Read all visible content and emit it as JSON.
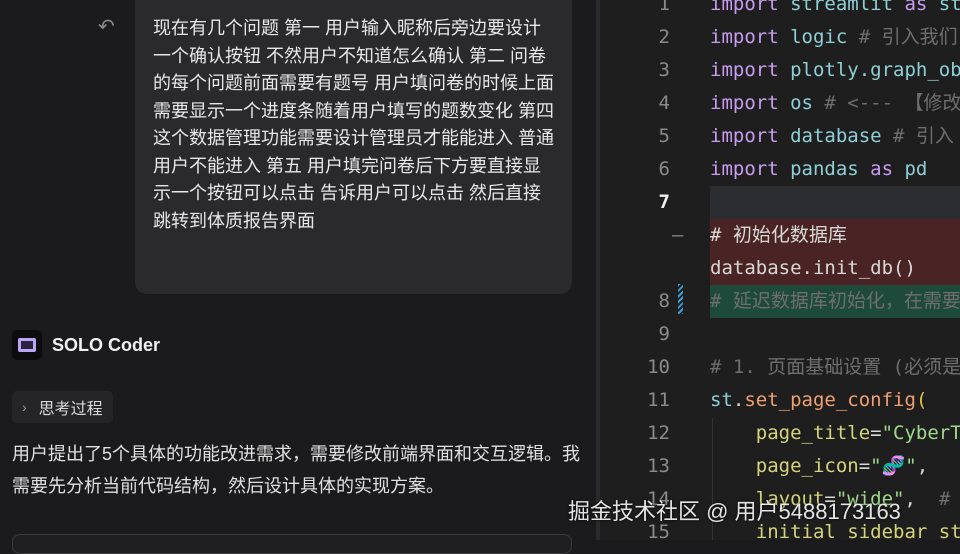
{
  "chat": {
    "undo_icon": "undo-icon",
    "user_message": "现在有几个问题 第一 用户输入昵称后旁边要设计一个确认按钮 不然用户不知道怎么确认 第二 问卷的每个问题前面需要有题号 用户填问卷的时候上面需要显示一个进度条随着用户填写的题数变化 第四这个数据管理功能需要设计管理员才能能进入 普通用户不能进入 第五 用户填完问卷后下方要直接显示一个按钮可以点击 告诉用户可以点击 然后直接跳转到体质报告界面",
    "agent_name": "SOLO Coder",
    "thinking_label": "思考过程",
    "reply": "用户提出了5个具体的功能改进需求，需要修改前端界面和交互逻辑。我需要先分析当前代码结构，然后设计具体的实现方案。"
  },
  "editor": {
    "lines": [
      {
        "n": "1",
        "tokens": [
          [
            "k",
            "import "
          ],
          [
            "i",
            "streamlit "
          ],
          [
            "k",
            "as "
          ],
          [
            "i",
            "st"
          ]
        ]
      },
      {
        "n": "2",
        "tokens": [
          [
            "k",
            "import "
          ],
          [
            "i",
            "logic "
          ],
          [
            "c",
            "# 引入我们"
          ]
        ]
      },
      {
        "n": "3",
        "tokens": [
          [
            "k",
            "import "
          ],
          [
            "i",
            "plotly.graph_ob"
          ]
        ]
      },
      {
        "n": "4",
        "tokens": [
          [
            "k",
            "import "
          ],
          [
            "i",
            "os "
          ],
          [
            "c",
            "# <--- 【修改"
          ]
        ]
      },
      {
        "n": "5",
        "tokens": [
          [
            "k",
            "import "
          ],
          [
            "i",
            "database "
          ],
          [
            "c",
            "# 引入"
          ]
        ]
      },
      {
        "n": "6",
        "tokens": [
          [
            "k",
            "import "
          ],
          [
            "i",
            "pandas "
          ],
          [
            "k",
            "as "
          ],
          [
            "i",
            "pd"
          ]
        ]
      },
      {
        "n": "7",
        "state": "current",
        "tokens": []
      },
      {
        "n": "",
        "state": "deleted",
        "tokens": [
          [
            "t",
            "# 初始化数据库"
          ]
        ]
      },
      {
        "n": "",
        "state": "deleted",
        "tokens": [
          [
            "t",
            "database.init_db()"
          ]
        ]
      },
      {
        "n": "8",
        "state": "added",
        "tokens": [
          [
            "c",
            "# 延迟数据库初始化，在需要"
          ]
        ]
      },
      {
        "n": "9",
        "tokens": []
      },
      {
        "n": "10",
        "tokens": [
          [
            "c",
            "# 1. 页面基础设置 (必须是"
          ]
        ]
      },
      {
        "n": "11",
        "tokens": [
          [
            "i",
            "st"
          ],
          [
            "t",
            "."
          ],
          [
            "f",
            "set_page_config"
          ],
          [
            "y",
            "("
          ]
        ]
      },
      {
        "n": "12",
        "tokens": [
          [
            "p",
            "    page_title"
          ],
          [
            "t",
            "="
          ],
          [
            "s",
            "\"CyberT"
          ]
        ]
      },
      {
        "n": "13",
        "tokens": [
          [
            "p",
            "    page_icon"
          ],
          [
            "t",
            "="
          ],
          [
            "s",
            "\"🧬\""
          ],
          [
            "t",
            ","
          ]
        ]
      },
      {
        "n": "14",
        "tokens": [
          [
            "p",
            "    layout"
          ],
          [
            "t",
            "="
          ],
          [
            "s",
            "\"wide\""
          ],
          [
            "t",
            ",  "
          ],
          [
            "c",
            "# "
          ]
        ]
      },
      {
        "n": "15",
        "tokens": [
          [
            "p",
            "    initial_sidebar_st"
          ]
        ]
      }
    ]
  },
  "watermark": "掘金技术社区 @ 用户5488173163"
}
